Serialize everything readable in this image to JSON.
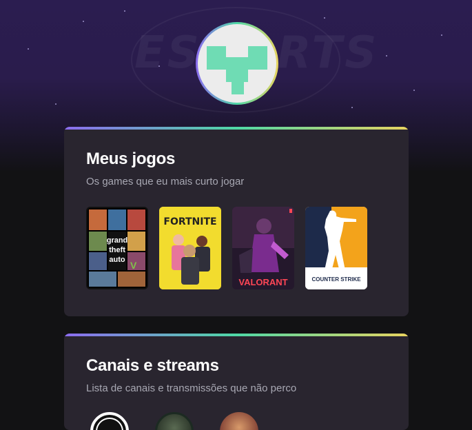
{
  "header": {
    "watermark": "ESPORTS"
  },
  "games_card": {
    "title": "Meus jogos",
    "subtitle": "Os games que eu mais curto jogar",
    "games": [
      {
        "name": "grand theft auto V"
      },
      {
        "name": "FORTNITE"
      },
      {
        "name": "VALORANT"
      },
      {
        "name": "COUNTER STRIKE"
      }
    ]
  },
  "channels_card": {
    "title": "Canais e streams",
    "subtitle": "Lista de canais e transmissões que não perco"
  },
  "colors": {
    "gradient_start": "#8c6cf0",
    "gradient_mid": "#4fd8a6",
    "gradient_end": "#e8d460",
    "card_bg": "#29252f",
    "page_bg": "#121214"
  }
}
